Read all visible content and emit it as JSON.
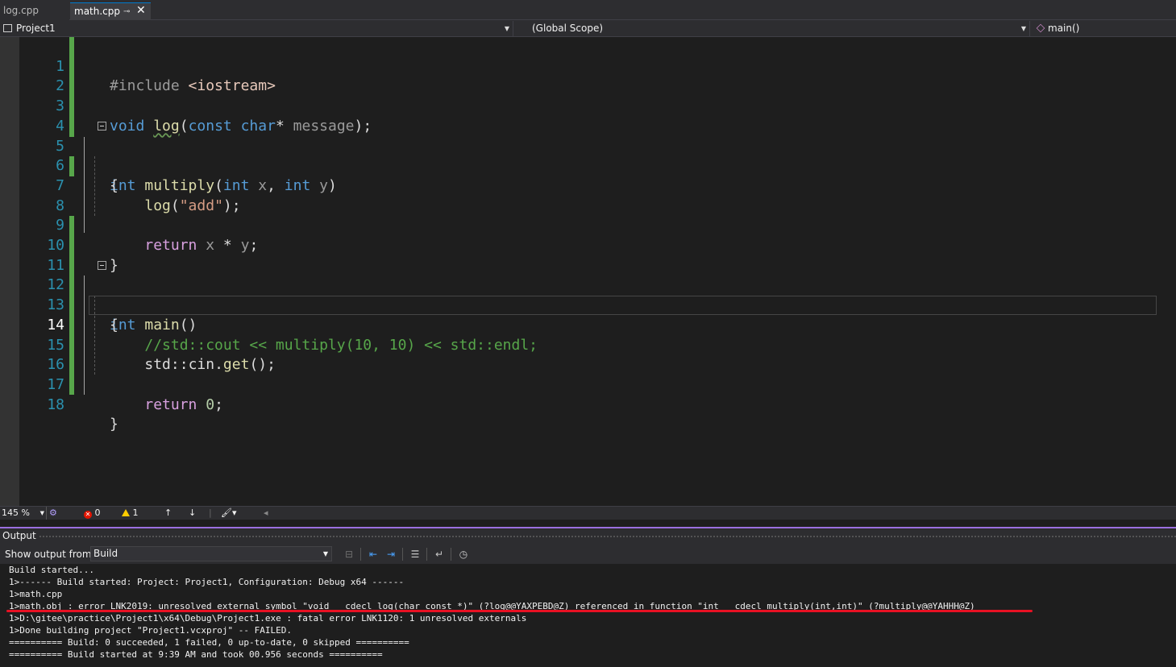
{
  "tabs": [
    {
      "label": "log.cpp",
      "active": false
    },
    {
      "label": "math.cpp",
      "active": true,
      "pin_icon": "pin-icon",
      "close_icon": "close-icon"
    }
  ],
  "navbar": {
    "project": "Project1",
    "scope": "(Global Scope)",
    "function": "main()"
  },
  "editor": {
    "current_line": 14,
    "line_numbers": [
      "1",
      "2",
      "3",
      "4",
      "5",
      "6",
      "7",
      "8",
      "9",
      "10",
      "11",
      "12",
      "13",
      "14",
      "15",
      "16",
      "17",
      "18"
    ],
    "code": {
      "l1_pp": "#include",
      "l1_inc": "<iostream>",
      "l3_void": "void",
      "l3_log": "log",
      "l3_p1": "(",
      "l3_const": "const",
      "l3_char": "char",
      "l3_p2": "* ",
      "l3_msg": "message",
      "l3_p3": ");",
      "l5_int": "int",
      "l5_fn": "multiply",
      "l5_p1": "(",
      "l5_int2": "int",
      "l5_x": "x",
      "l5_comma": ", ",
      "l5_int3": "int",
      "l5_y": "y",
      "l5_p2": ")",
      "brace_open": "{",
      "brace_close": "}",
      "l7_log": "log",
      "l7_p1": "(",
      "l7_str": "\"add\"",
      "l7_p2": ");",
      "return_kw": "return",
      "l9_x": "x",
      "l9_op": " * ",
      "l9_y": "y",
      "l9_end": ";",
      "l12_int": "int",
      "l12_main": "main",
      "l12_par": "()",
      "l14_comment": "//std::cout << multiply(10, 10) << std::endl;",
      "l15_std": "std",
      "l15_sep": "::",
      "l15_cin": "cin",
      "l15_dot": ".",
      "l15_get": "get",
      "l15_end": "();",
      "l17_zero": "0",
      "l17_end": ";"
    }
  },
  "editor_status": {
    "zoom": "145 %",
    "errors": "0",
    "warnings": "1"
  },
  "output": {
    "title": "Output",
    "show_from_label": "Show output from:",
    "show_from_value": "Build",
    "lines": [
      "Build started...",
      "1>------ Build started: Project: Project1, Configuration: Debug x64 ------",
      "1>math.cpp",
      "1>math.obj : error LNK2019: unresolved external symbol \"void __cdecl log(char const *)\" (?log@@YAXPEBD@Z) referenced in function \"int __cdecl multiply(int,int)\" (?multiply@@YAHHH@Z)",
      "1>D:\\gitee\\practice\\Project1\\x64\\Debug\\Project1.exe : fatal error LNK1120: 1 unresolved externals",
      "1>Done building project \"Project1.vcxproj\" -- FAILED.",
      "========== Build: 0 succeeded, 1 failed, 0 up-to-date, 0 skipped ==========",
      "========== Build started at 9:39 AM and took 00.956 seconds =========="
    ]
  },
  "colors": {
    "accent": "#007acc",
    "output_accent": "#9b6fe0",
    "error_underline": "#e81123",
    "change_bar": "#57a64a"
  }
}
